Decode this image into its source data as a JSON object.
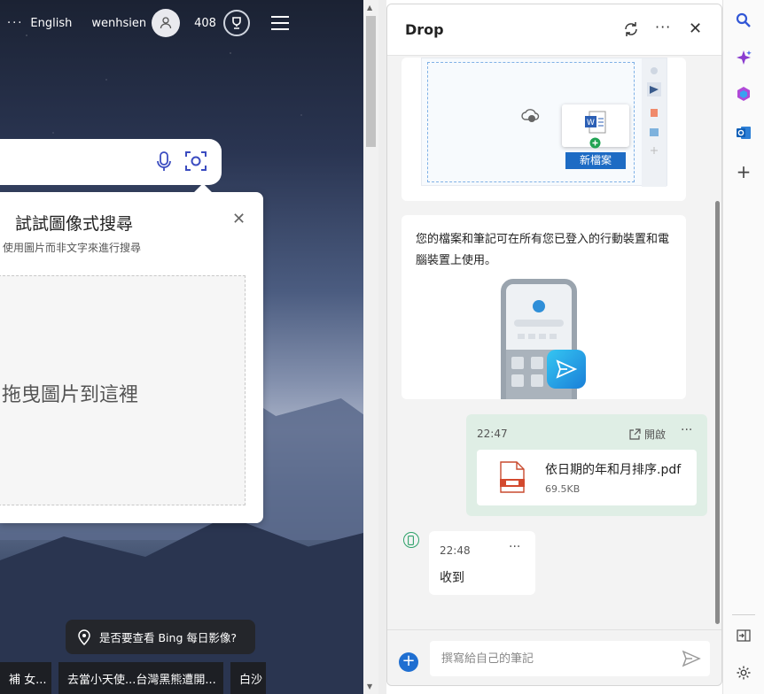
{
  "bing": {
    "topbar": {
      "dots": "···",
      "language": "English",
      "username": "wenhsien",
      "points": "408"
    },
    "visual_search": {
      "title": "試試圖像式搜尋",
      "subtitle": "使用圖片而非文字來進行搜尋",
      "drop_text": "拖曳圖片到這裡"
    },
    "daily_image_prompt": "是否要查看 Bing 每日影像?",
    "news": [
      "補 女...",
      "去當小天使...台灣黑熊遭開...",
      "白沙"
    ]
  },
  "drop": {
    "title": "Drop",
    "card_illustration_badge": "新檔案",
    "info_text": "您的檔案和筆記可在所有您已登入的行動裝置和電腦裝置上使用。",
    "sent_message": {
      "time": "22:47",
      "open_label": "開啟",
      "more": "···",
      "file_name": "依日期的年和月排序.pdf",
      "file_size": "69.5KB"
    },
    "received_message": {
      "time": "22:48",
      "more": "···",
      "text": "收到"
    },
    "note_placeholder": "撰寫給自己的筆記"
  },
  "colors": {
    "accent_blue": "#1f6fd1",
    "sent_bubble": "#dfeee5",
    "device_green": "#2ea26a"
  }
}
